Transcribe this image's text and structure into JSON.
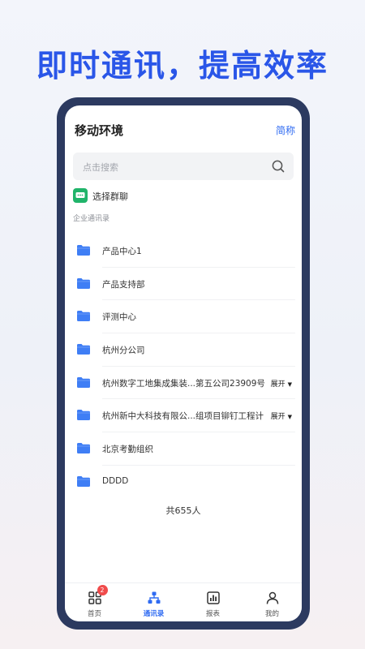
{
  "headline": "即时通讯，提高效率",
  "header": {
    "title": "移动环境",
    "simple_label": "简称"
  },
  "search": {
    "placeholder": "点击搜索"
  },
  "group_chat": {
    "label": "选择群聊"
  },
  "section_label": "企业通讯录",
  "org_items": [
    {
      "name": "产品中心1",
      "expand": ""
    },
    {
      "name": "产品支持部",
      "expand": ""
    },
    {
      "name": "评测中心",
      "expand": ""
    },
    {
      "name": "杭州分公司",
      "expand": ""
    },
    {
      "name": "杭州数字工地集成集装...第五公司23909号",
      "expand": "展开"
    },
    {
      "name": "杭州新中大科技有限公...组项目铆钉工程计",
      "expand": "展开"
    },
    {
      "name": "北京考勤组织",
      "expand": ""
    },
    {
      "name": "DDDD",
      "expand": ""
    }
  ],
  "total_count": "共655人",
  "tabs": [
    {
      "label": "首页",
      "icon": "grid-icon",
      "badge": "2",
      "active": false
    },
    {
      "label": "通讯录",
      "icon": "org-chart-icon",
      "badge": "",
      "active": true
    },
    {
      "label": "报表",
      "icon": "bar-chart-icon",
      "badge": "",
      "active": false
    },
    {
      "label": "我的",
      "icon": "person-icon",
      "badge": "",
      "active": false
    }
  ],
  "colors": {
    "accent": "#2f6bf2",
    "headline": "#2a56e8",
    "phone_frame": "#2c3a60",
    "group_icon": "#20b46a",
    "badge": "#f04b4b"
  }
}
